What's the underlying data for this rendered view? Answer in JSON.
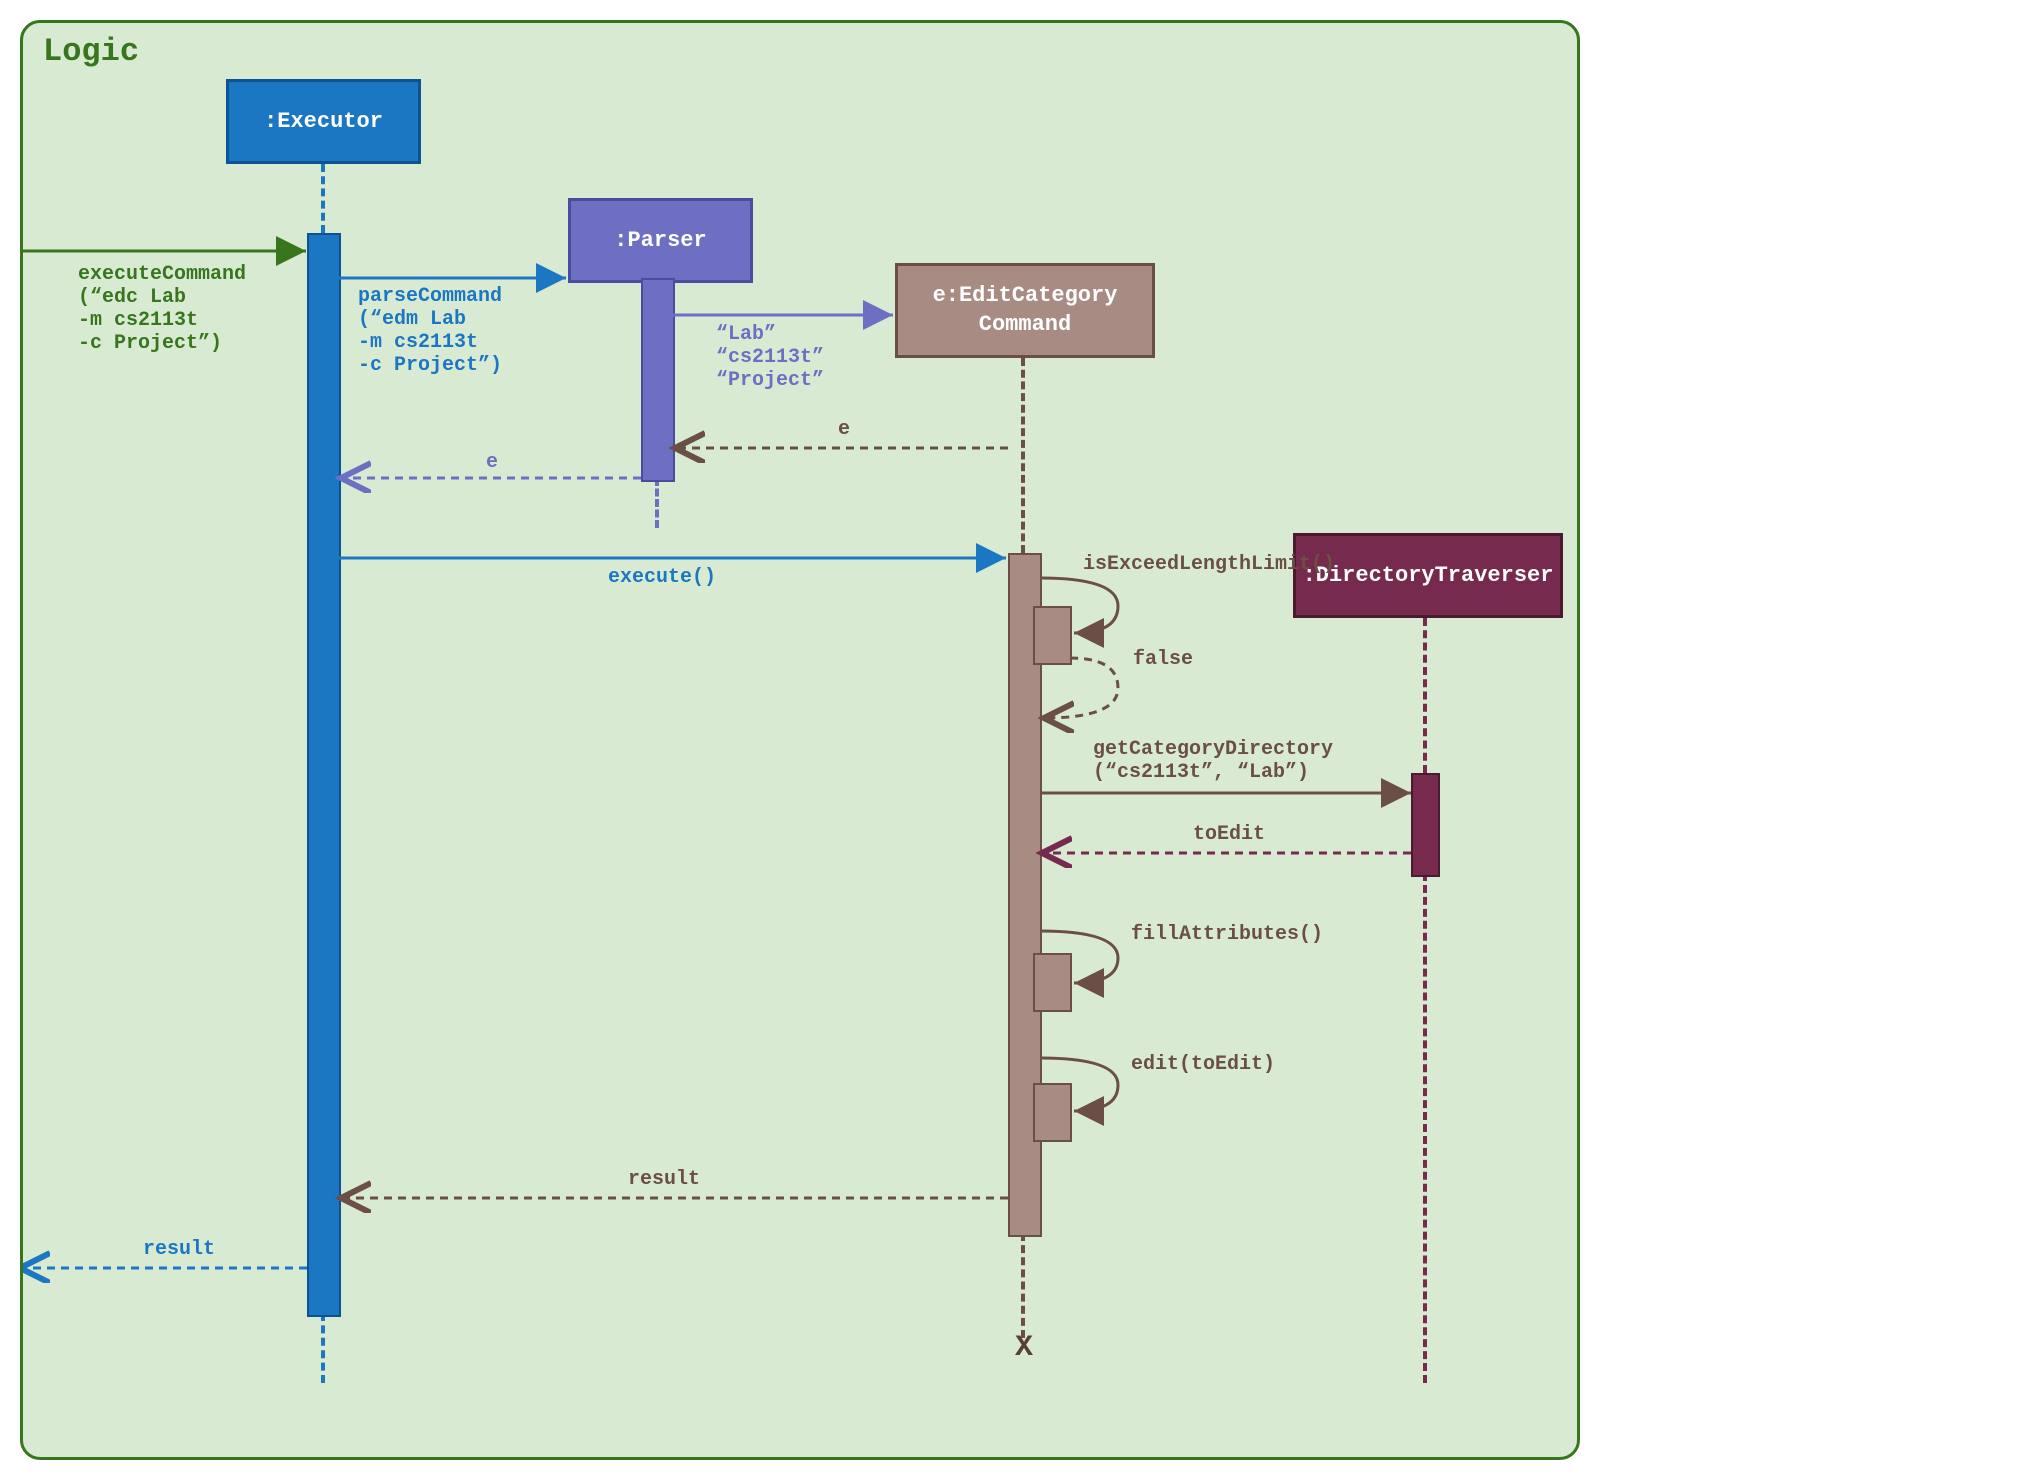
{
  "frame": {
    "label": "Logic"
  },
  "lifelines": {
    "executor": ":Executor",
    "parser": ":Parser",
    "editcmd": "e:EditCategory\nCommand",
    "dirtrav": ":DirectoryTraverser"
  },
  "messages": {
    "executeCommand": "executeCommand\n(“edc Lab\n-m cs2113t\n-c Project”)",
    "parseCommand": "parseCommand\n(“edm Lab\n-m cs2113t\n-c Project”)",
    "createArgs": "“Lab”\n“cs2113t”\n“Project”",
    "return_e1": "e",
    "return_e2": "e",
    "execute": "execute()",
    "isExceed": "isExceedLengthLimit()",
    "falseRet": "false",
    "getCatDir": "getCategoryDirectory\n(“cs2113t”, “Lab”)",
    "toEdit": "toEdit",
    "fillAttr": "fillAttributes()",
    "editCall": "edit(toEdit)",
    "result1": "result",
    "result2": "result"
  },
  "chart_data": {
    "type": "sequence_diagram",
    "frame": "Logic",
    "participants": [
      {
        "id": "executor",
        "name": ":Executor"
      },
      {
        "id": "parser",
        "name": ":Parser"
      },
      {
        "id": "editcmd",
        "name": "e:EditCategoryCommand"
      },
      {
        "id": "dirtrav",
        "name": ":DirectoryTraverser"
      }
    ],
    "events": [
      {
        "from": "external",
        "to": "executor",
        "type": "sync",
        "message": "executeCommand(\"edc Lab -m cs2113t -c Project\")"
      },
      {
        "from": "executor",
        "to": "parser",
        "type": "sync",
        "message": "parseCommand(\"edm Lab -m cs2113t -c Project\")"
      },
      {
        "from": "parser",
        "to": "editcmd",
        "type": "create",
        "message": "\"Lab\" \"cs2113t\" \"Project\""
      },
      {
        "from": "editcmd",
        "to": "parser",
        "type": "return",
        "message": "e"
      },
      {
        "from": "parser",
        "to": "executor",
        "type": "return",
        "message": "e"
      },
      {
        "from": "executor",
        "to": "editcmd",
        "type": "sync",
        "message": "execute()"
      },
      {
        "from": "editcmd",
        "to": "editcmd",
        "type": "self",
        "message": "isExceedLengthLimit()"
      },
      {
        "from": "editcmd",
        "to": "editcmd",
        "type": "self-return",
        "message": "false"
      },
      {
        "from": "editcmd",
        "to": "dirtrav",
        "type": "sync",
        "message": "getCategoryDirectory(\"cs2113t\", \"Lab\")"
      },
      {
        "from": "dirtrav",
        "to": "editcmd",
        "type": "return",
        "message": "toEdit"
      },
      {
        "from": "editcmd",
        "to": "editcmd",
        "type": "self",
        "message": "fillAttributes()"
      },
      {
        "from": "editcmd",
        "to": "editcmd",
        "type": "self",
        "message": "edit(toEdit)"
      },
      {
        "from": "editcmd",
        "to": "executor",
        "type": "return",
        "message": "result"
      },
      {
        "from": "executor",
        "to": "external",
        "type": "return",
        "message": "result"
      },
      {
        "type": "destroy",
        "target": "editcmd"
      }
    ]
  }
}
